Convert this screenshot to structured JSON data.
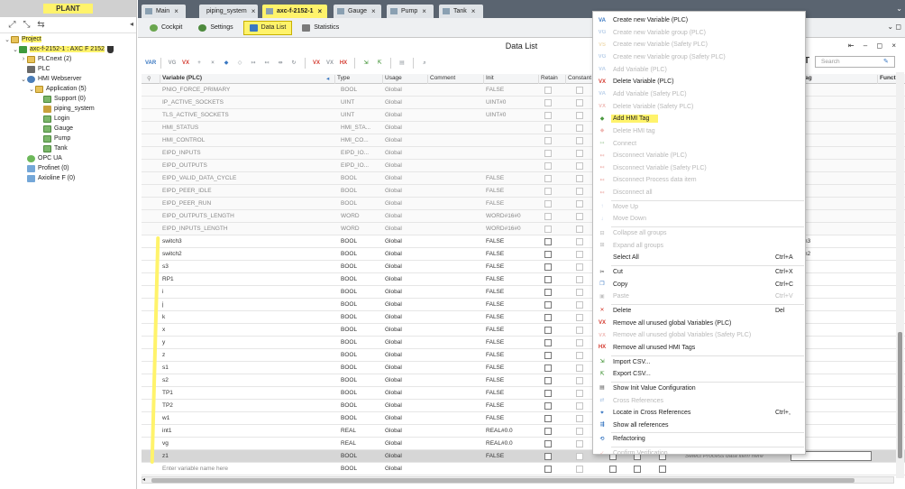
{
  "left_panel": {
    "title": "PLANT",
    "tree": [
      {
        "label": "Project",
        "level": 0,
        "icon": "folder-icon",
        "expander": "⌄",
        "highlight": true
      },
      {
        "label": "axc-f-2152-1 : AXC F 2152",
        "level": 1,
        "icon": "controller-icon",
        "expander": "⌄",
        "highlight": true
      },
      {
        "label": "PLCnext (2)",
        "level": 2,
        "icon": "folder-icon",
        "expander": "›",
        "highlight": false
      },
      {
        "label": "PLC",
        "level": 2,
        "icon": "plc-icon",
        "expander": "",
        "highlight": false
      },
      {
        "label": "HMI Webserver",
        "level": 2,
        "icon": "globe-icon",
        "expander": "⌄",
        "highlight": false
      },
      {
        "label": "Application (5)",
        "level": 3,
        "icon": "folder-icon",
        "expander": "⌄",
        "highlight": false
      },
      {
        "label": "Support (0)",
        "level": 4,
        "icon": "page-icon",
        "expander": "",
        "highlight": false
      },
      {
        "label": "piping_system",
        "level": 4,
        "icon": "home-icon",
        "expander": "",
        "highlight": false
      },
      {
        "label": "Login",
        "level": 4,
        "icon": "page-icon",
        "expander": "",
        "highlight": false
      },
      {
        "label": "Gauge",
        "level": 4,
        "icon": "page-icon",
        "expander": "",
        "highlight": false
      },
      {
        "label": "Pump",
        "level": 4,
        "icon": "page-icon",
        "expander": "",
        "highlight": false
      },
      {
        "label": "Tank",
        "level": 4,
        "icon": "page-icon",
        "expander": "",
        "highlight": false
      },
      {
        "label": "OPC UA",
        "level": 2,
        "icon": "opc-icon",
        "expander": "",
        "highlight": false
      },
      {
        "label": "Profinet (0)",
        "level": 2,
        "icon": "network-icon",
        "expander": "",
        "highlight": false
      },
      {
        "label": "Axioline F (0)",
        "level": 2,
        "icon": "network-icon",
        "expander": "",
        "highlight": false
      }
    ]
  },
  "tabs": [
    {
      "label": "Main",
      "active": false,
      "close": "×"
    },
    {
      "label": "piping_system",
      "active": false,
      "close": "×"
    },
    {
      "label": "axc-f-2152-1",
      "active": true,
      "close": "×"
    },
    {
      "label": "Gauge",
      "active": false,
      "close": "×"
    },
    {
      "label": "Pump",
      "active": false,
      "close": "×"
    },
    {
      "label": "Tank",
      "active": false,
      "close": "×"
    }
  ],
  "subtabs": [
    {
      "label": "Cockpit",
      "active": false
    },
    {
      "label": "Settings",
      "active": false
    },
    {
      "label": "Data List",
      "active": true
    },
    {
      "label": "Statistics",
      "active": false
    }
  ],
  "data_list": {
    "title": "Data List",
    "search_placeholder": "Search",
    "columns": [
      "Variable (PLC)",
      "Type",
      "Usage",
      "Comment",
      "Init",
      "Retain",
      "Constant",
      "tag",
      "Funct"
    ],
    "rows": [
      {
        "name": "PNIO_FORCE_PRIMARY",
        "type": "BOOL",
        "usage": "Global",
        "init": "FALSE",
        "grey": true
      },
      {
        "name": "IP_ACTIVE_SOCKETS",
        "type": "UINT",
        "usage": "Global",
        "init": "UINT#0",
        "grey": true
      },
      {
        "name": "TLS_ACTIVE_SOCKETS",
        "type": "UINT",
        "usage": "Global",
        "init": "UINT#0",
        "grey": true
      },
      {
        "name": "HMI_STATUS",
        "type": "HMI_STA...",
        "usage": "Global",
        "init": "",
        "grey": true
      },
      {
        "name": "HMI_CONTROL",
        "type": "HMI_CO...",
        "usage": "Global",
        "init": "",
        "grey": true
      },
      {
        "name": "EIPD_INPUTS",
        "type": "EIPD_IO...",
        "usage": "Global",
        "init": "",
        "grey": true
      },
      {
        "name": "EIPD_OUTPUTS",
        "type": "EIPD_IO...",
        "usage": "Global",
        "init": "",
        "grey": true
      },
      {
        "name": "EIPD_VALID_DATA_CYCLE",
        "type": "BOOL",
        "usage": "Global",
        "init": "FALSE",
        "grey": true
      },
      {
        "name": "EIPD_PEER_IDLE",
        "type": "BOOL",
        "usage": "Global",
        "init": "FALSE",
        "grey": true
      },
      {
        "name": "EIPD_PEER_RUN",
        "type": "BOOL",
        "usage": "Global",
        "init": "FALSE",
        "grey": true
      },
      {
        "name": "EIPD_OUTPUTS_LENGTH",
        "type": "WORD",
        "usage": "Global",
        "init": "WORD#16#0",
        "grey": true
      },
      {
        "name": "EIPD_INPUTS_LENGTH",
        "type": "WORD",
        "usage": "Global",
        "init": "WORD#16#0",
        "grey": true
      },
      {
        "name": "switch3",
        "type": "BOOL",
        "usage": "Global",
        "init": "FALSE",
        "grey": false,
        "tag": "h3"
      },
      {
        "name": "switch2",
        "type": "BOOL",
        "usage": "Global",
        "init": "FALSE",
        "grey": false,
        "tag": "h2"
      },
      {
        "name": "s3",
        "type": "BOOL",
        "usage": "Global",
        "init": "FALSE",
        "grey": false
      },
      {
        "name": "RP1",
        "type": "BOOL",
        "usage": "Global",
        "init": "FALSE",
        "grey": false
      },
      {
        "name": "i",
        "type": "BOOL",
        "usage": "Global",
        "init": "FALSE",
        "grey": false
      },
      {
        "name": "j",
        "type": "BOOL",
        "usage": "Global",
        "init": "FALSE",
        "grey": false
      },
      {
        "name": "k",
        "type": "BOOL",
        "usage": "Global",
        "init": "FALSE",
        "grey": false
      },
      {
        "name": "x",
        "type": "BOOL",
        "usage": "Global",
        "init": "FALSE",
        "grey": false
      },
      {
        "name": "y",
        "type": "BOOL",
        "usage": "Global",
        "init": "FALSE",
        "grey": false
      },
      {
        "name": "z",
        "type": "BOOL",
        "usage": "Global",
        "init": "FALSE",
        "grey": false
      },
      {
        "name": "s1",
        "type": "BOOL",
        "usage": "Global",
        "init": "FALSE",
        "grey": false
      },
      {
        "name": "s2",
        "type": "BOOL",
        "usage": "Global",
        "init": "FALSE",
        "grey": false
      },
      {
        "name": "TP1",
        "type": "BOOL",
        "usage": "Global",
        "init": "FALSE",
        "grey": false
      },
      {
        "name": "TP2",
        "type": "BOOL",
        "usage": "Global",
        "init": "FALSE",
        "grey": false
      },
      {
        "name": "w1",
        "type": "BOOL",
        "usage": "Global",
        "init": "FALSE",
        "grey": false
      },
      {
        "name": "int1",
        "type": "REAL",
        "usage": "Global",
        "init": "REAL#0.0",
        "grey": false
      },
      {
        "name": "vg",
        "type": "REAL",
        "usage": "Global",
        "init": "REAL#0.0",
        "grey": false
      },
      {
        "name": "z1",
        "type": "BOOL",
        "usage": "Global",
        "init": "FALSE",
        "grey": false,
        "selected": true,
        "process": "Select Process data item here"
      },
      {
        "name": "Enter variable name here",
        "type": "BOOL",
        "usage": "Global",
        "init": "",
        "grey": false,
        "placeholder": true
      }
    ]
  },
  "context_menu": {
    "items": [
      {
        "label": "Create new Variable (PLC)",
        "key": "",
        "disabled": false,
        "icon": "var-add-icon",
        "sep_before": false
      },
      {
        "label": "Create new Variable group (PLC)",
        "key": "",
        "disabled": true,
        "icon": "var-group-icon",
        "sep_before": false
      },
      {
        "label": "Create new Variable (Safety PLC)",
        "key": "",
        "disabled": true,
        "icon": "var-safety-icon",
        "sep_before": false
      },
      {
        "label": "Create new Variable group (Safety PLC)",
        "key": "",
        "disabled": true,
        "icon": "var-group-icon",
        "sep_before": false
      },
      {
        "label": "Add Variable (PLC)",
        "key": "",
        "disabled": true,
        "icon": "var-add-icon",
        "sep_before": false
      },
      {
        "label": "Delete Variable (PLC)",
        "key": "",
        "disabled": false,
        "icon": "var-delete-icon",
        "sep_before": false
      },
      {
        "label": "Add Variable (Safety PLC)",
        "key": "",
        "disabled": true,
        "icon": "var-add-icon",
        "sep_before": false
      },
      {
        "label": "Delete Variable (Safety PLC)",
        "key": "",
        "disabled": true,
        "icon": "var-delete-icon",
        "sep_before": false
      },
      {
        "label": "Add HMI Tag",
        "key": "",
        "disabled": false,
        "icon": "hmi-tag-add-icon",
        "sep_before": false,
        "highlight": true
      },
      {
        "label": "Delete HMI tag",
        "key": "",
        "disabled": true,
        "icon": "hmi-tag-delete-icon",
        "sep_before": false
      },
      {
        "label": "Connect",
        "key": "",
        "disabled": true,
        "icon": "connect-icon",
        "sep_before": false
      },
      {
        "label": "Disconnect Variable (PLC)",
        "key": "",
        "disabled": true,
        "icon": "disconnect-icon",
        "sep_before": false
      },
      {
        "label": "Disconnect Variable (Safety PLC)",
        "key": "",
        "disabled": true,
        "icon": "disconnect-icon",
        "sep_before": false
      },
      {
        "label": "Disconnect Process data item",
        "key": "",
        "disabled": true,
        "icon": "disconnect-icon",
        "sep_before": false
      },
      {
        "label": "Disconnect all",
        "key": "",
        "disabled": true,
        "icon": "disconnect-icon",
        "sep_before": false
      },
      {
        "label": "Move Up",
        "key": "",
        "disabled": true,
        "icon": "arrow-up-icon",
        "sep_before": true
      },
      {
        "label": "Move Down",
        "key": "",
        "disabled": true,
        "icon": "arrow-down-icon",
        "sep_before": false
      },
      {
        "label": "Collapse all groups",
        "key": "",
        "disabled": true,
        "icon": "collapse-icon",
        "sep_before": true
      },
      {
        "label": "Expand all groups",
        "key": "",
        "disabled": true,
        "icon": "expand-icon",
        "sep_before": false
      },
      {
        "label": "Select All",
        "key": "Ctrl+A",
        "disabled": false,
        "icon": "",
        "sep_before": false
      },
      {
        "label": "Cut",
        "key": "Ctrl+X",
        "disabled": false,
        "icon": "scissors-icon",
        "sep_before": true
      },
      {
        "label": "Copy",
        "key": "Ctrl+C",
        "disabled": false,
        "icon": "copy-icon",
        "sep_before": false
      },
      {
        "label": "Paste",
        "key": "Ctrl+V",
        "disabled": true,
        "icon": "paste-icon",
        "sep_before": false
      },
      {
        "label": "Delete",
        "key": "Del",
        "disabled": false,
        "icon": "delete-x-icon",
        "sep_before": true
      },
      {
        "label": "Remove all unused global Variables (PLC)",
        "key": "",
        "disabled": false,
        "icon": "var-remove-icon",
        "sep_before": false
      },
      {
        "label": "Remove all unused global Variables (Safety PLC)",
        "key": "",
        "disabled": true,
        "icon": "var-remove-icon",
        "sep_before": false
      },
      {
        "label": "Remove all unused HMI Tags",
        "key": "",
        "disabled": false,
        "icon": "hmi-remove-icon",
        "sep_before": false
      },
      {
        "label": "Import CSV...",
        "key": "",
        "disabled": false,
        "icon": "import-icon",
        "sep_before": true
      },
      {
        "label": "Export CSV...",
        "key": "",
        "disabled": false,
        "icon": "export-icon",
        "sep_before": false
      },
      {
        "label": "Show Init Value Configuration",
        "key": "",
        "disabled": false,
        "icon": "config-icon",
        "sep_before": true
      },
      {
        "label": "Cross References",
        "key": "",
        "disabled": true,
        "icon": "crossref-icon",
        "sep_before": false
      },
      {
        "label": "Locate in Cross References",
        "key": "Ctrl+,",
        "disabled": false,
        "icon": "locate-icon",
        "sep_before": false
      },
      {
        "label": "Show all references",
        "key": "",
        "disabled": false,
        "icon": "references-icon",
        "sep_before": false
      },
      {
        "label": "Refactoring",
        "key": "",
        "disabled": false,
        "icon": "refactor-icon",
        "sep_before": true
      },
      {
        "label": "Confirm Verification",
        "key": "",
        "disabled": true,
        "icon": "verify-icon",
        "sep_before": true
      }
    ]
  },
  "colors": {
    "highlight": "#fff36b",
    "tabbar": "#5a6470",
    "accent_red": "#d43a2f",
    "accent_blue": "#3a78c2"
  }
}
